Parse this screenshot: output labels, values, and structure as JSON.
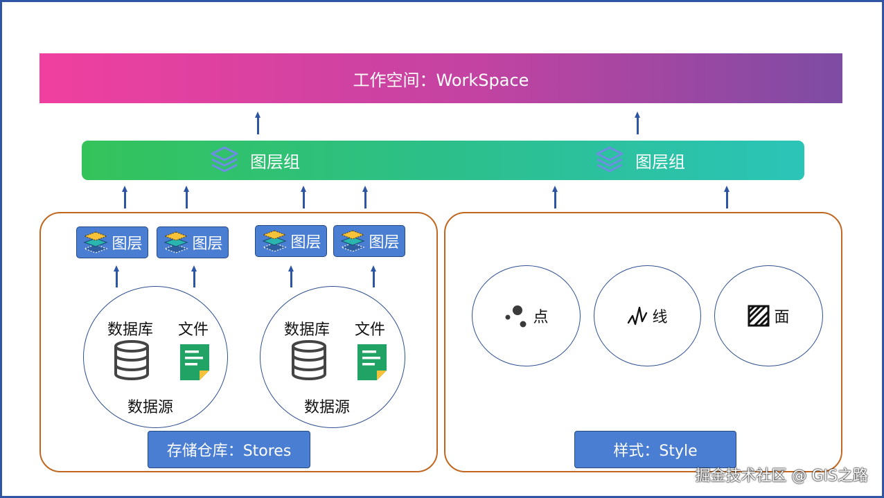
{
  "workspace": {
    "label": "工作空间：WorkSpace"
  },
  "layer_groups": [
    {
      "label": "图层组",
      "icon": "layers-stack-icon"
    },
    {
      "label": "图层组",
      "icon": "layers-stack-icon"
    }
  ],
  "stores_panel": {
    "layers": [
      {
        "label": "图层",
        "icon": "layers-colored-icon"
      },
      {
        "label": "图层",
        "icon": "layers-colored-icon"
      },
      {
        "label": "图层",
        "icon": "layers-colored-icon"
      },
      {
        "label": "图层",
        "icon": "layers-colored-icon"
      }
    ],
    "datasources": [
      {
        "database_label": "数据库",
        "file_label": "文件",
        "title": "数据源"
      },
      {
        "database_label": "数据库",
        "file_label": "文件",
        "title": "数据源"
      }
    ],
    "label": "存储仓库：Stores"
  },
  "style_panel": {
    "items": [
      {
        "label": "点",
        "icon": "point-scatter-icon"
      },
      {
        "label": "线",
        "icon": "line-zigzag-icon"
      },
      {
        "label": "面",
        "icon": "polygon-hatch-icon"
      }
    ],
    "label": "样式：Style"
  },
  "watermark": "掘金技术社区 @ GIS之路",
  "colors": {
    "workspace_gradient": [
      "#f0409f",
      "#7d4ca3"
    ],
    "group_gradient": [
      "#34c35a",
      "#2bc4b8"
    ],
    "badge_blue": "#4a7ed2",
    "arrow_blue": "#2d55a3",
    "panel_border": "#c0661f",
    "file_green": "#21a366"
  }
}
